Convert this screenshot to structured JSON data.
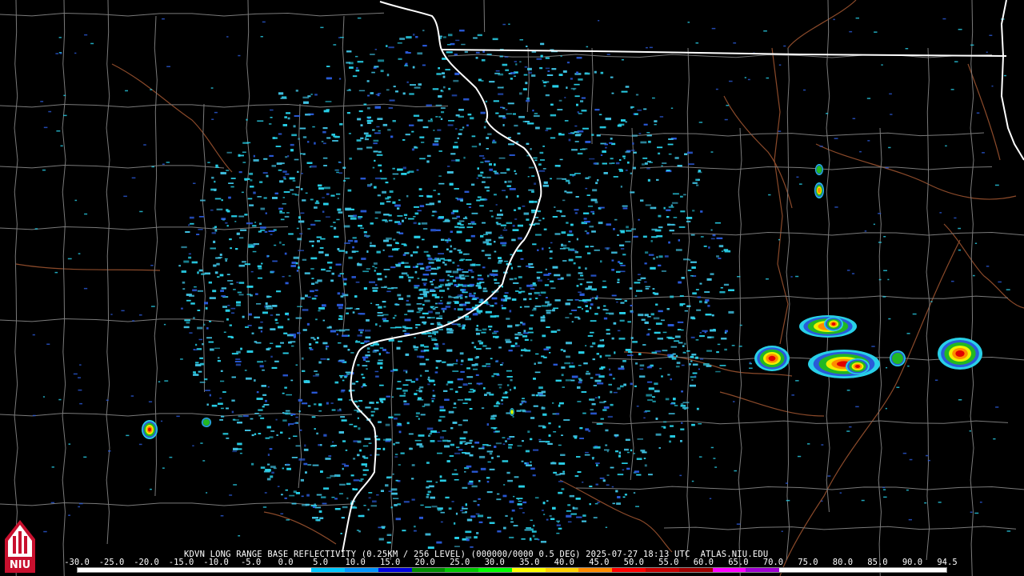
{
  "product": {
    "caption": "KDVN LONG RANGE BASE REFLECTIVITY (0.25KM / 256 LEVEL) (000000/0000 0.5 DEG) 2025-07-27 18:13 UTC  ATLAS.NIU.EDU"
  },
  "logo": {
    "text": "NIU",
    "colors": {
      "red": "#c8102e",
      "white": "#ffffff",
      "black": "#000000"
    }
  },
  "colorscale": {
    "labels": [
      "-30.0",
      "-25.0",
      "-20.0",
      "-15.0",
      "-10.0",
      "-5.0",
      "0.0",
      "5.0",
      "10.0",
      "15.0",
      "20.0",
      "25.0",
      "30.0",
      "35.0",
      "40.0",
      "45.0",
      "50.0",
      "55.0",
      "60.0",
      "65.0",
      "70.0",
      "75.0",
      "80.0",
      "85.0",
      "90.0",
      "94.5"
    ],
    "colors": [
      "#ffffff",
      "#ffffff",
      "#ffffff",
      "#ffffff",
      "#ffffff",
      "#ffffff",
      "#ffffff",
      "#00c8ff",
      "#0096ff",
      "#0000e0",
      "#008c00",
      "#00c800",
      "#00ff00",
      "#ffff00",
      "#ffd200",
      "#ff8c00",
      "#ff0000",
      "#c80000",
      "#a00000",
      "#ff00ff",
      "#a000d2",
      "#ffffff",
      "#ffffff",
      "#ffffff",
      "#ffffff",
      "#ffffff"
    ]
  },
  "map_colors": {
    "background": "#000000",
    "county_lines": "#7a7a7a",
    "state_lines": "#ffffff",
    "rivers": "#8b4a2a",
    "echo_light": "#3fc0e0",
    "echo_cyan": "#28d0e8",
    "echo_blue": "#2a5ad8",
    "echo_green": "#22b822",
    "echo_yellow": "#f0f000",
    "echo_orange": "#ff8c00",
    "echo_red": "#e00000"
  }
}
